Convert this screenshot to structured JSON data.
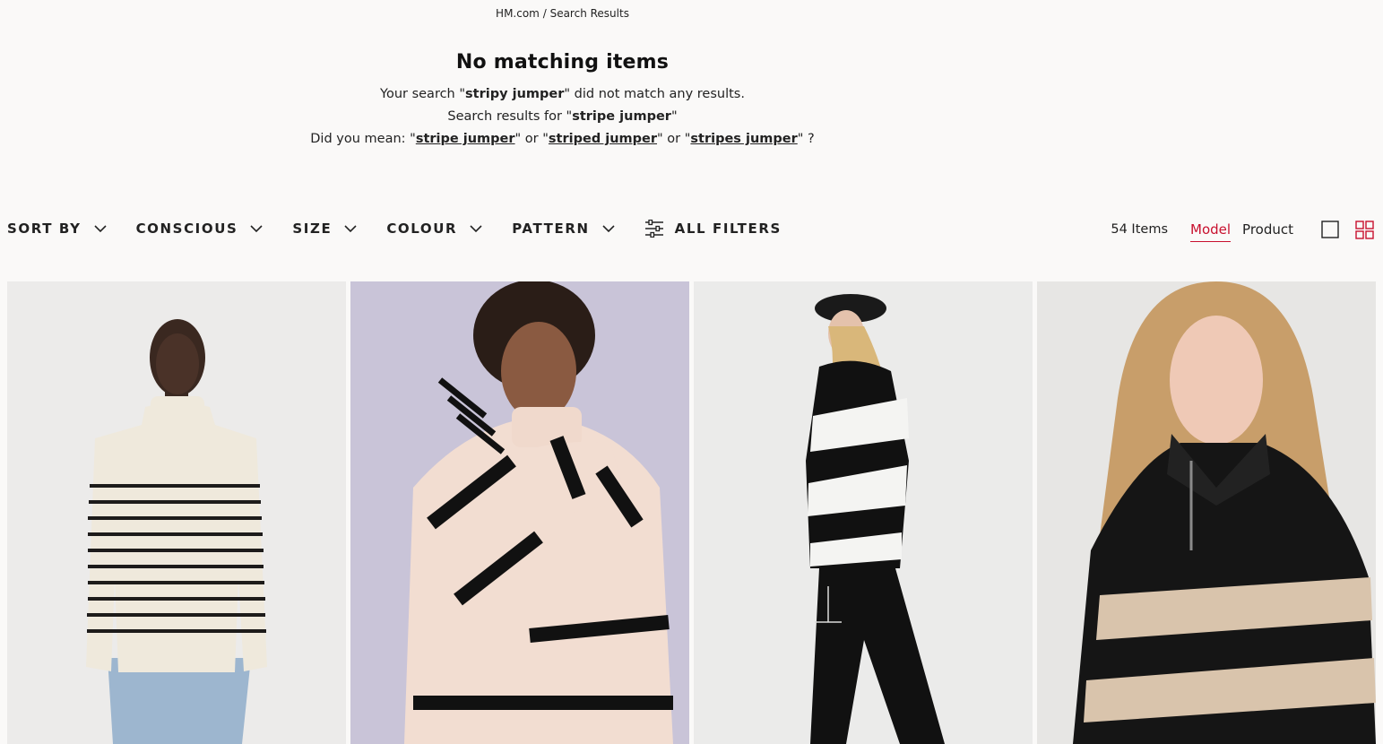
{
  "breadcrumb": {
    "site": "HM.com",
    "separator": "/",
    "current": "Search Results"
  },
  "message": {
    "title": "No matching items",
    "line1_prefix": "Your search \"",
    "query": "stripy jumper",
    "line1_suffix": "\" did not match any results.",
    "line2_prefix": "Search results for \"",
    "corrected": "stripe jumper",
    "line2_suffix": "\"",
    "line3_prefix": "Did you mean: \"",
    "suggestions": [
      "stripe jumper",
      "striped jumper",
      "stripes jumper"
    ],
    "or": "\" or \"",
    "line3_suffix": "\" ?"
  },
  "filters": {
    "items": [
      "SORT BY",
      "CONSCIOUS",
      "SIZE",
      "COLOUR",
      "PATTERN"
    ],
    "all_filters": "ALL FILTERS"
  },
  "results": {
    "count_label": "54 Items",
    "view_model": "Model",
    "view_product": "Product",
    "accent": "#c8102e"
  },
  "products": [
    {
      "name": "cream-stripe-turtleneck-jumper",
      "bg": "#ecebea"
    },
    {
      "name": "pink-ribbed-stripe-jumper",
      "bg": "#c9c4d8"
    },
    {
      "name": "black-white-stripe-oversized-jumper",
      "bg": "#ebebea"
    },
    {
      "name": "black-beige-stripe-zip-jumper",
      "bg": "#e7e6e4"
    }
  ]
}
